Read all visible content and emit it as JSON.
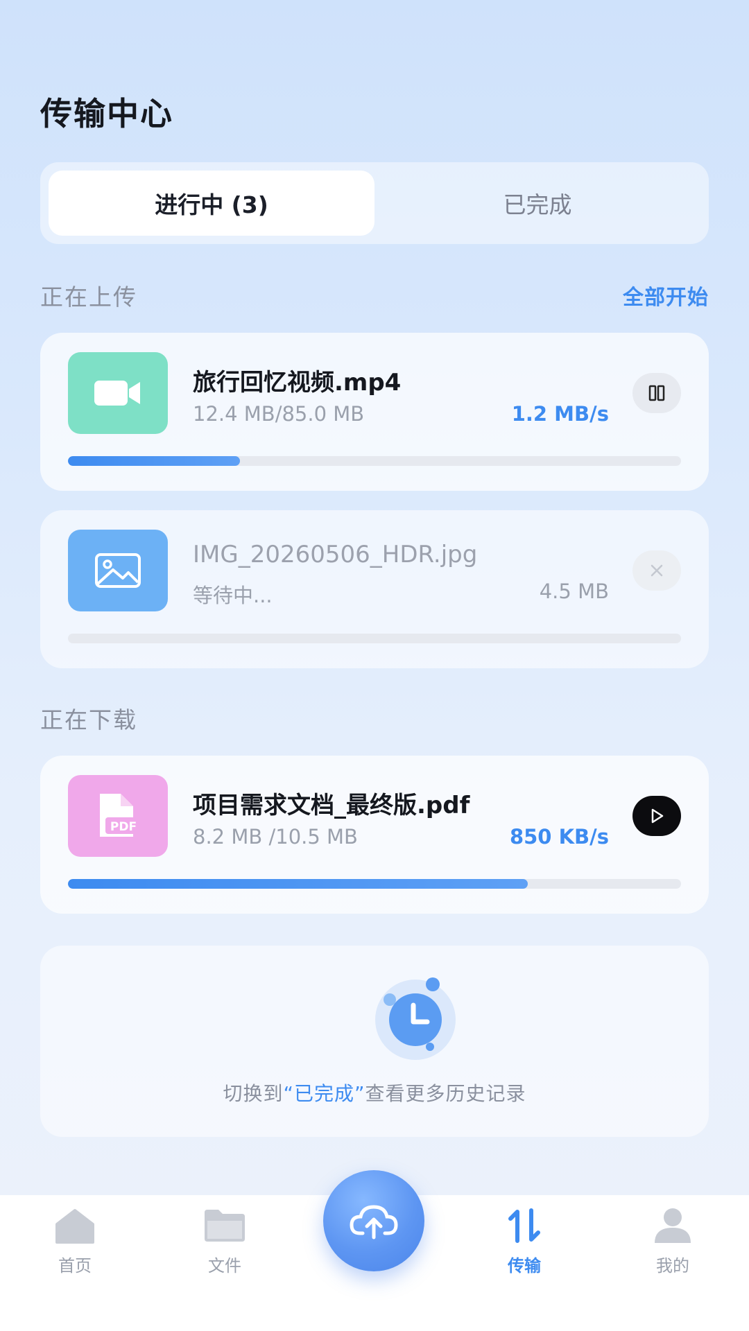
{
  "header": {
    "title": "传输中心"
  },
  "tabs": [
    {
      "label": "进行中 (3)",
      "active": true
    },
    {
      "label": "已完成",
      "active": false
    }
  ],
  "upload_section": {
    "title": "正在上传",
    "action_label": "全部开始",
    "items": [
      {
        "name": "旅行回忆视频.mp4",
        "size_text": "12.4 MB/85.0 MB",
        "speed": "1.2 MB/s",
        "progress": 0.28,
        "thumb_color": "#7ee0c6",
        "icon": "video-icon",
        "action": "pause-icon"
      },
      {
        "name": "IMG_20260506_HDR.jpg",
        "size_text": "等待中...",
        "speed": "4.5 MB",
        "progress": 0,
        "thumb_color": "#6cb1f5",
        "icon": "image-icon",
        "action": "close-icon"
      }
    ]
  },
  "download_section": {
    "title": "正在下载",
    "items": [
      {
        "name": "项目需求文档_最终版.pdf",
        "size_text": "8.2 MB /10.5 MB",
        "speed": "850 KB/s",
        "progress": 0.75,
        "thumb_color": "#f0a8ea",
        "icon": "pdf-icon",
        "icon_text": "PDF",
        "action": "play-icon"
      }
    ]
  },
  "history": {
    "prefix": "切换到",
    "highlight": "“已完成”",
    "suffix": "查看更多历史记录"
  },
  "tabbar": {
    "items": [
      {
        "label": "首页",
        "icon": "home-icon",
        "active": false
      },
      {
        "label": "文件",
        "icon": "folder-icon",
        "active": false
      },
      {
        "label": "传输",
        "icon": "transfer-icon",
        "active": true
      },
      {
        "label": "我的",
        "icon": "user-icon",
        "active": false
      }
    ],
    "fab_icon": "cloud-upload-icon"
  },
  "colors": {
    "accent": "#3d8bf0",
    "video_thumb": "#7ee0c6",
    "image_thumb": "#6cb1f5",
    "pdf_thumb": "#f0a8ea"
  }
}
